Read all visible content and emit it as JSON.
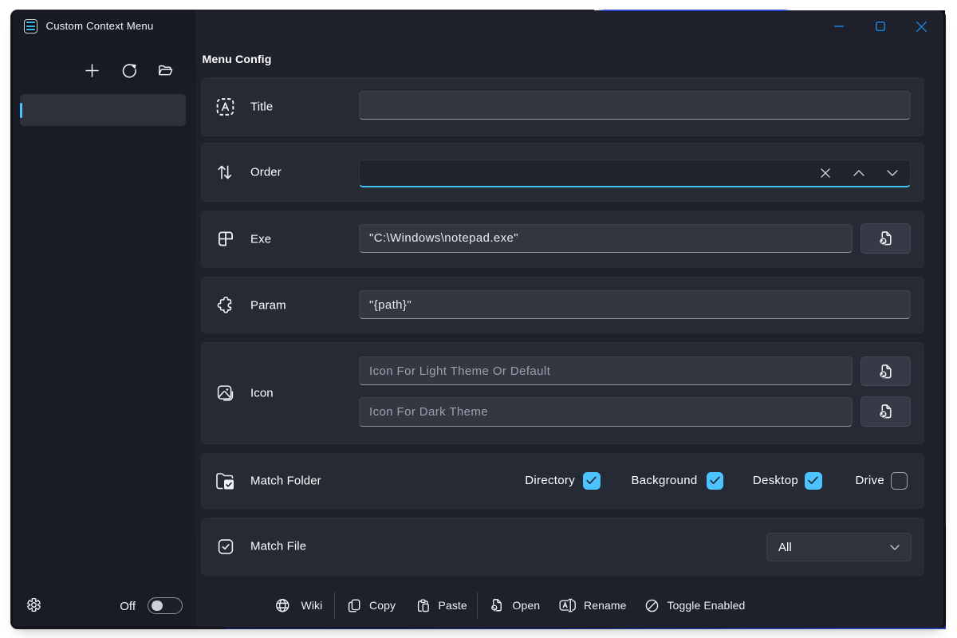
{
  "window": {
    "title": "Custom Context Menu",
    "caption_buttons": [
      "minimize",
      "maximize",
      "close"
    ]
  },
  "colors": {
    "accent": "#4cc2ff",
    "caption_icon_blue": "#1f82d9",
    "sidebar_bg": "#151823",
    "main_bg": "#1e212b",
    "card_bg": "#252834",
    "behind_window_blue": "#2b3da6"
  },
  "sidebar": {
    "toolbar": [
      {
        "icon": "add-icon"
      },
      {
        "icon": "refresh-icon"
      },
      {
        "icon": "folder-open-icon"
      }
    ],
    "items": [
      {
        "label": "",
        "selected": true
      }
    ],
    "footer": {
      "settings_icon": "gear-icon",
      "toggle_label": "Off",
      "toggle_state": "off"
    }
  },
  "main": {
    "heading": "Menu Config",
    "rows": [
      {
        "icon": "text-field-icon",
        "label": "Title",
        "value": ""
      },
      {
        "icon": "sort-order-icon",
        "label": "Order",
        "value": "",
        "focused": true,
        "buttons": [
          "clear",
          "increment",
          "decrement"
        ]
      },
      {
        "icon": "app-window-icon",
        "label": "Exe",
        "value": "\"C:\\Windows\\notepad.exe\"",
        "browse": true
      },
      {
        "icon": "puzzle-icon",
        "label": "Param",
        "value": "\"{path}\""
      },
      {
        "icon": "image-icon",
        "label": "Icon",
        "inputs": [
          {
            "placeholder": "Icon For Light Theme Or Default",
            "browse": true
          },
          {
            "placeholder": "Icon For Dark Theme",
            "browse": true
          }
        ]
      },
      {
        "icon": "folder-check-icon",
        "label": "Match Folder",
        "checkboxes": [
          {
            "label": "Directory",
            "checked": true
          },
          {
            "label": "Background",
            "checked": true
          },
          {
            "label": "Desktop",
            "checked": true
          },
          {
            "label": "Drive",
            "checked": false
          }
        ]
      },
      {
        "icon": "checkbox-icon",
        "label": "Match File",
        "dropdown": {
          "value": "All"
        }
      }
    ],
    "commandbar": [
      {
        "icon": "globe-icon",
        "label": "Wiki"
      },
      {
        "icon": "copy-icon",
        "label": "Copy"
      },
      {
        "icon": "paste-icon",
        "label": "Paste"
      },
      {
        "icon": "open-file-icon",
        "label": "Open"
      },
      {
        "icon": "rename-icon",
        "label": "Rename"
      },
      {
        "icon": "block-icon",
        "label": "Toggle Enabled"
      }
    ]
  }
}
